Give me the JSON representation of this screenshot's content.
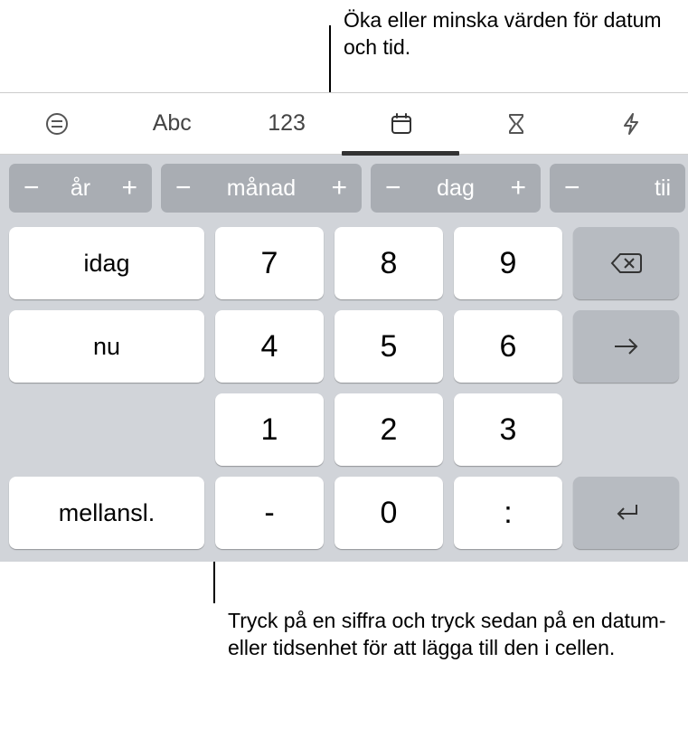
{
  "callouts": {
    "top": "Öka eller minska värden för datum och tid.",
    "bottom": "Tryck på en siffra och tryck sedan på en datum- eller tidsenhet för att lägga till den i cellen."
  },
  "toolbar": {
    "abc": "Abc",
    "num": "123"
  },
  "steppers": {
    "year": {
      "minus": "−",
      "label": "år",
      "plus": "+"
    },
    "month": {
      "minus": "−",
      "label": "månad",
      "plus": "+"
    },
    "day": {
      "minus": "−",
      "label": "dag",
      "plus": "+"
    },
    "time": {
      "minus": "−",
      "label": "tii",
      "plus": "+"
    }
  },
  "keys": {
    "today": "idag",
    "now": "nu",
    "space": "mellansl.",
    "n7": "7",
    "n8": "8",
    "n9": "9",
    "n4": "4",
    "n5": "5",
    "n6": "6",
    "n1": "1",
    "n2": "2",
    "n3": "3",
    "dash": "-",
    "n0": "0",
    "colon": ":"
  }
}
